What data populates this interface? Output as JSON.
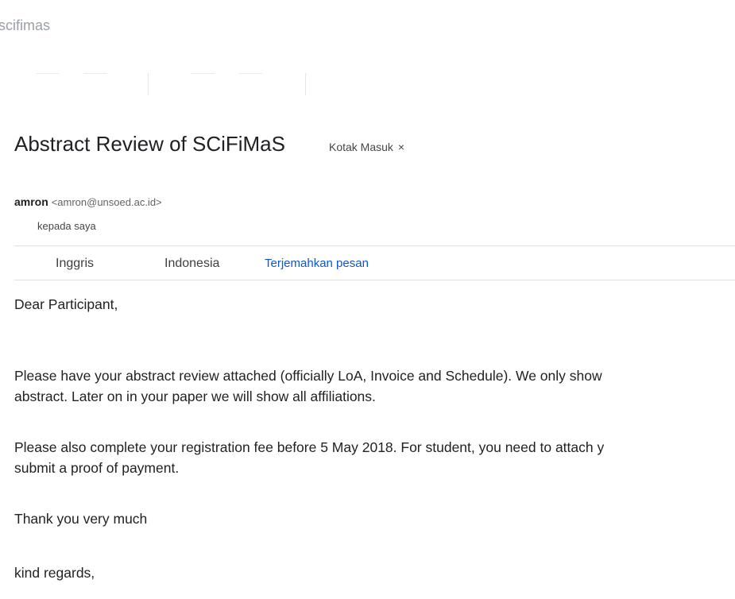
{
  "breadcrumb": "scifimas",
  "email": {
    "subject": "Abstract Review of SCiFiMaS",
    "label": "Kotak Masuk",
    "label_remove": "×",
    "sender_name": "amron",
    "sender_email": "<amron@unsoed.ac.id>",
    "recipient": "kepada saya"
  },
  "translate": {
    "from_lang": "Inggris",
    "to_lang": "Indonesia",
    "translate_link": "Terjemahkan pesan"
  },
  "body": {
    "greeting": "Dear Participant,",
    "p2_line1": "Please have your abstract review attached (officially LoA, Invoice and Schedule). We only show",
    "p2_line2": "abstract. Later on in your paper we will show all affiliations.",
    "p3_line1": "Please also complete your registration fee before 5 May 2018. For student, you need to attach y",
    "p3_line2": "submit a proof of payment.",
    "thanks": "Thank you very much",
    "closing": "kind regards,"
  }
}
